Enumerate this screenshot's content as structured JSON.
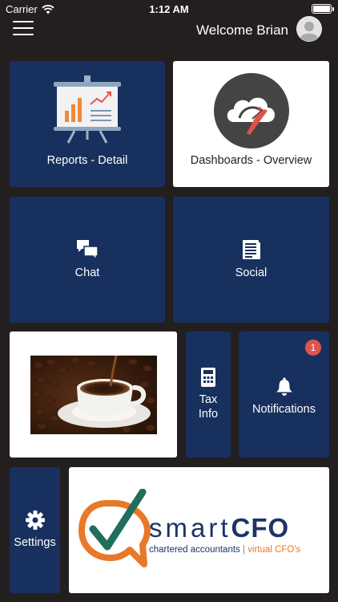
{
  "status_bar": {
    "carrier": "Carrier",
    "time": "1:12 AM"
  },
  "header": {
    "welcome": "Welcome Brian"
  },
  "tiles": {
    "reports": {
      "label": "Reports - Detail",
      "icon": "presentation-chart-icon"
    },
    "dashboards": {
      "label": "Dashboards - Overview",
      "icon": "cloud-gauge-icon"
    },
    "chat": {
      "label": "Chat",
      "icon": "chat-bubbles-icon"
    },
    "social": {
      "label": "Social",
      "icon": "newspaper-icon"
    },
    "tax": {
      "label_line1": "Tax",
      "label_line2": "Info",
      "icon": "calculator-icon"
    },
    "notifications": {
      "label": "Notifications",
      "badge": "1",
      "icon": "bell-icon"
    },
    "settings": {
      "label": "Settings",
      "icon": "gear-icon"
    },
    "coffee": {
      "image": "coffee-cup-photo"
    }
  },
  "brand": {
    "smart": "smart",
    "cfo": "CFO",
    "tagline_left": "chartered accountants",
    "separator": "|",
    "tagline_right": "virtual CFO's"
  },
  "colors": {
    "background": "#231f1f",
    "tile_blue": "#17305e",
    "badge_red": "#e0534a",
    "brand_orange": "#e8782a",
    "brand_teal": "#1f6f5c",
    "brand_navy": "#1c3466"
  }
}
